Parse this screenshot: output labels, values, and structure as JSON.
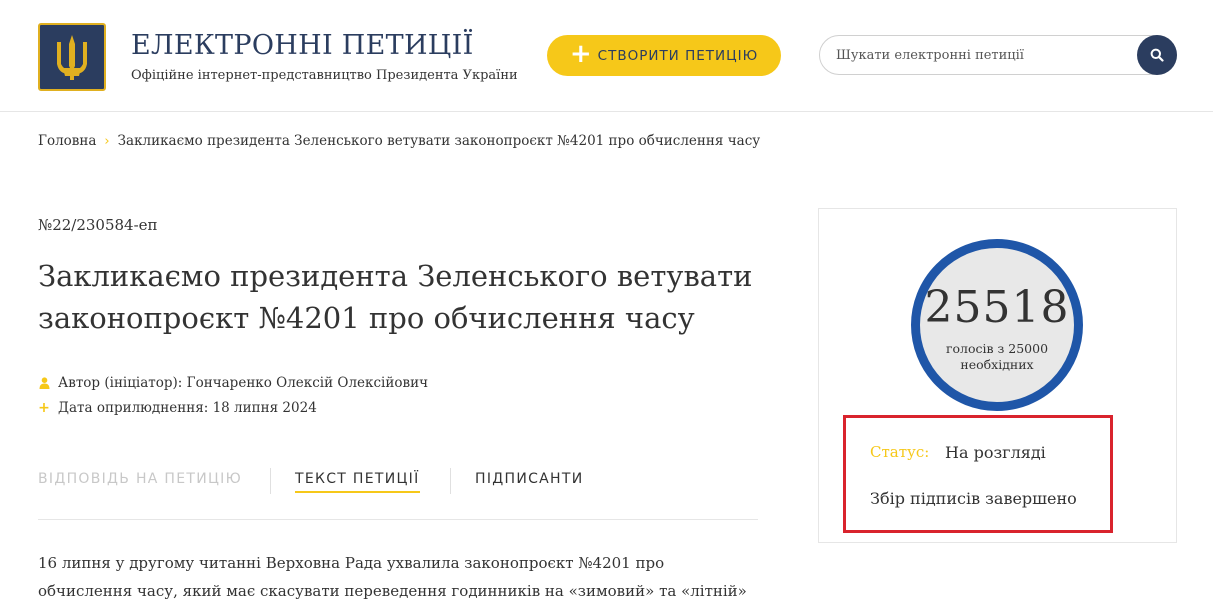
{
  "header": {
    "title": "ЕЛЕКТРОННІ ПЕТИЦІЇ",
    "subtitle": "Офіційне інтернет-представництво Президента України",
    "create_button": "СТВОРИТИ ПЕТИЦІЮ",
    "search_placeholder": "Шукати електронні петиції"
  },
  "breadcrumb": {
    "home": "Головна",
    "current": "Закликаємо президента Зеленського ветувати законопроєкт №4201 про обчислення часу"
  },
  "petition": {
    "number": "№22/230584-еп",
    "title": "Закликаємо президента Зеленського ветувати законопроєкт №4201 про обчислення часу",
    "author": "Автор (ініціатор): Гончаренко Олексій Олексійович",
    "date": "Дата оприлюднення: 18 липня 2024",
    "body": "16 липня у другому читанні Верховна Рада ухвалила законопроєкт №4201 про обчислення часу, який має скасувати переведення годинників на «зимовий» та «літній» час."
  },
  "tabs": [
    {
      "label": "ВІДПОВІДЬ НА ПЕТИЦІЮ",
      "state": "disabled"
    },
    {
      "label": "ТЕКСТ ПЕТИЦІЇ",
      "state": "active"
    },
    {
      "label": "ПІДПИСАНТИ",
      "state": "normal"
    }
  ],
  "votes": {
    "count": "25518",
    "label_line1": "голосів з 25000",
    "label_line2": "необхідних"
  },
  "status": {
    "label": "Статус:",
    "value": "На розгляді",
    "collection": "Збір підписів завершено"
  },
  "colors": {
    "brand_navy": "#2b3d5f",
    "accent_yellow": "#f6c819",
    "counter_blue": "#1f56a8",
    "highlight_red": "#d9232d"
  }
}
